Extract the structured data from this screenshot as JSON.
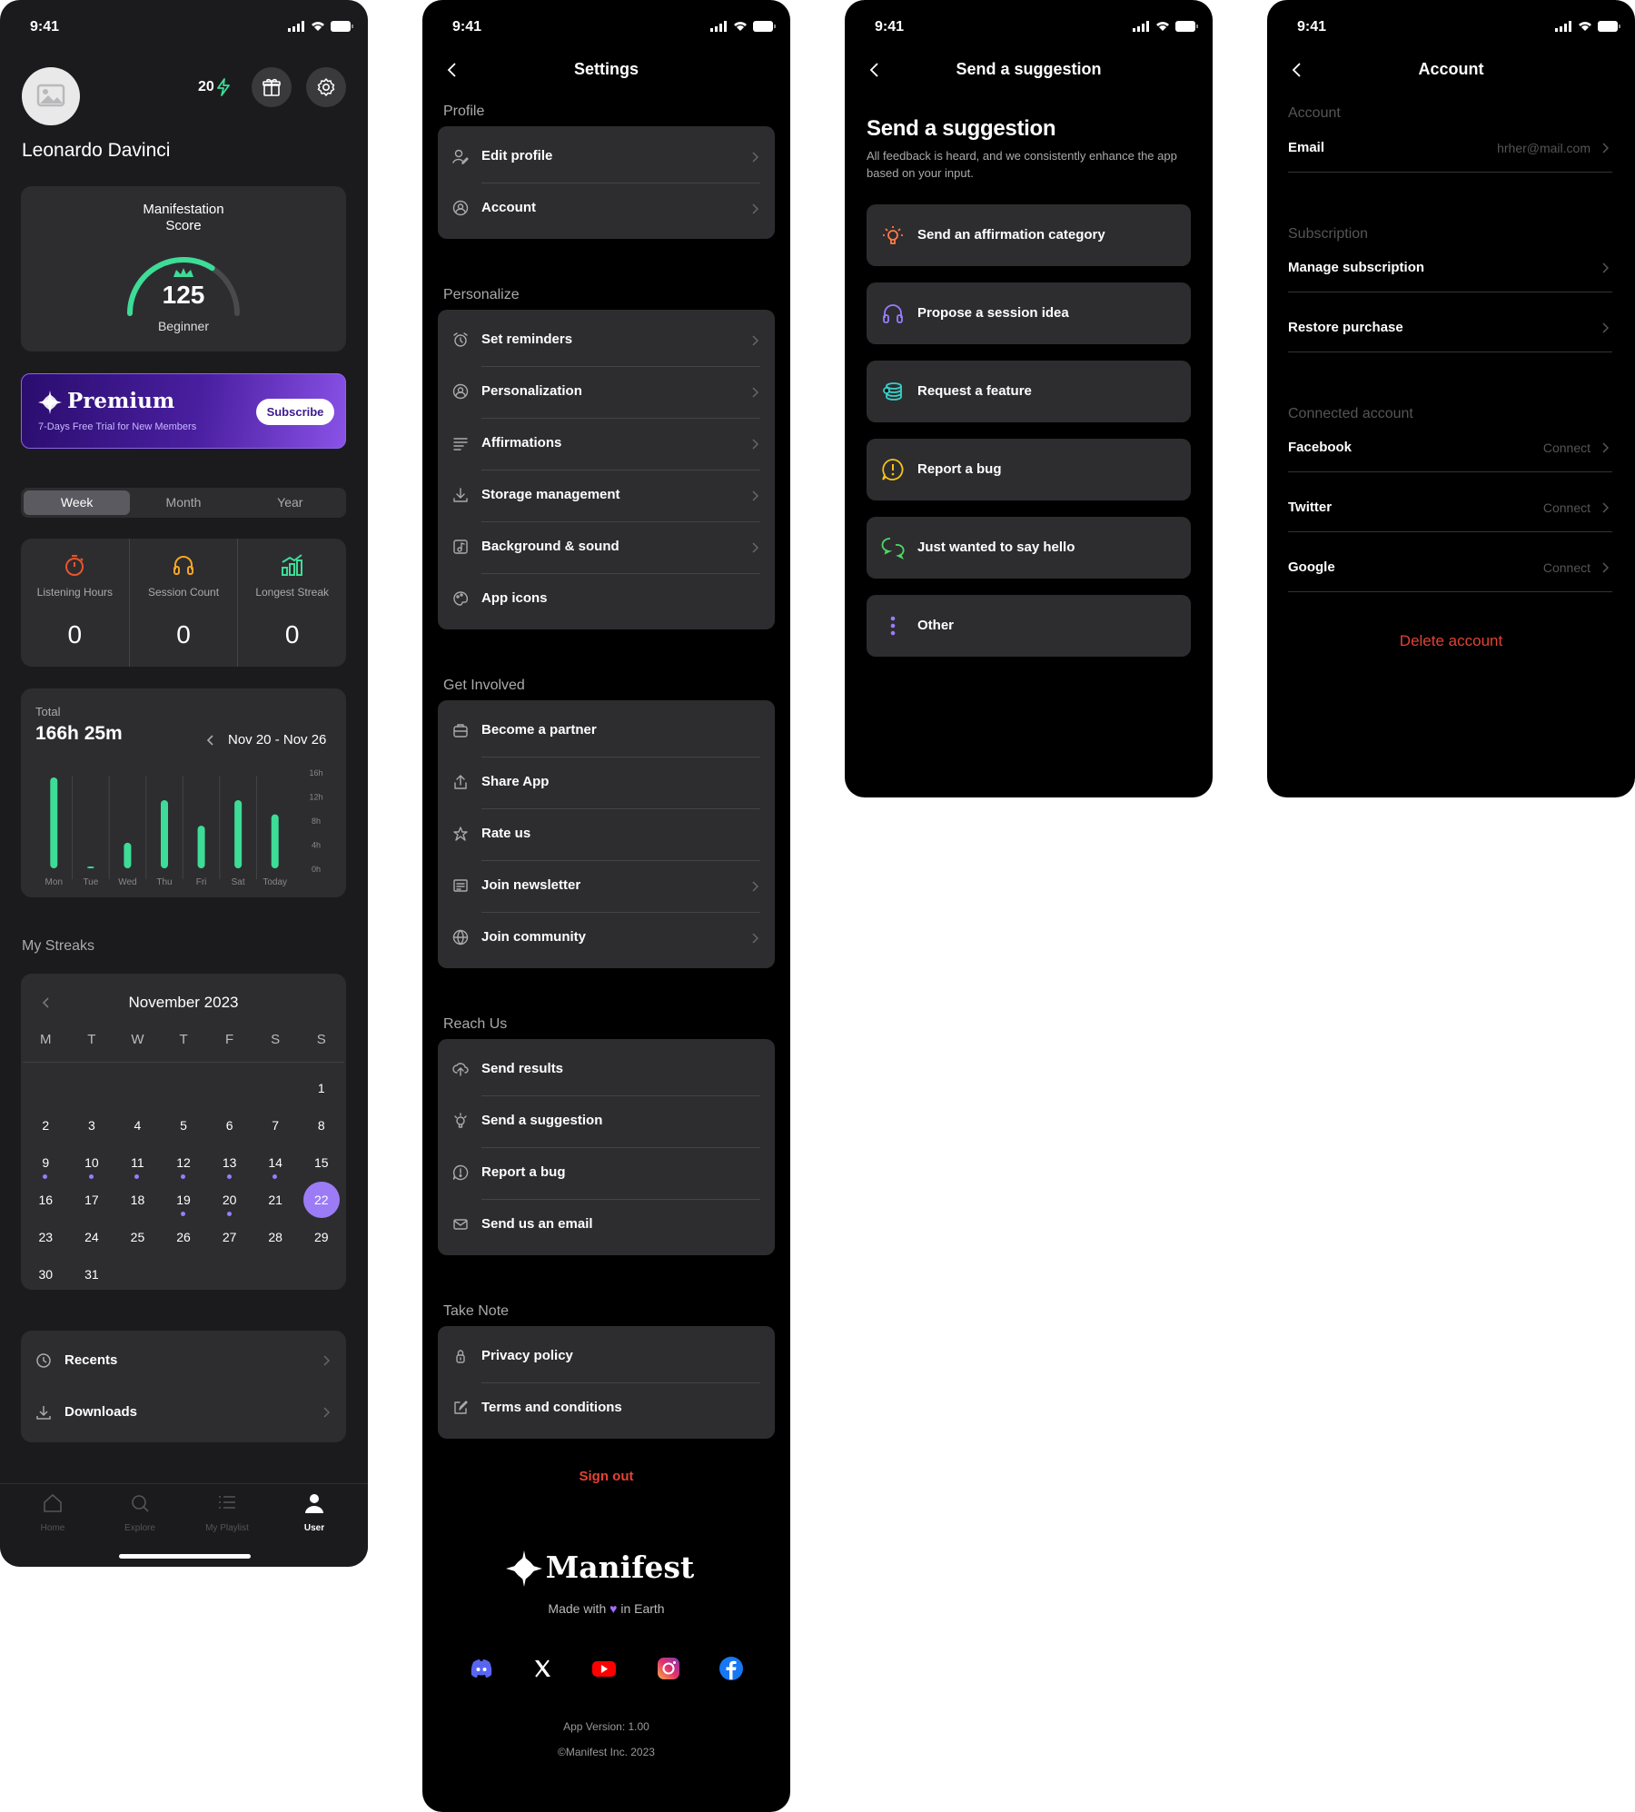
{
  "status_time": "9:41",
  "home": {
    "user_name": "Leonardo Davinci",
    "energy": "20",
    "score": {
      "title": "Manifestation Score",
      "value": "125",
      "level": "Beginner",
      "progress": 0.68
    },
    "premium": {
      "title": "Premium",
      "subtitle": "7-Days Free Trial for New Members",
      "button": "Subscribe"
    },
    "periods": [
      "Week",
      "Month",
      "Year"
    ],
    "stats": [
      {
        "label": "Listening Hours",
        "value": "0",
        "icon": "stopwatch-icon",
        "color": "#e8552c"
      },
      {
        "label": "Session Count",
        "value": "0",
        "icon": "headphones-icon",
        "color": "#f5a623"
      },
      {
        "label": "Longest Streak",
        "value": "0",
        "icon": "bar-chart-icon",
        "color": "#3ddc97"
      }
    ],
    "total": {
      "label": "Total",
      "value": "166h 25m",
      "range": "Nov 20 - Nov 26"
    },
    "chart_data": {
      "type": "bar",
      "categories": [
        "Mon",
        "Tue",
        "Wed",
        "Thu",
        "Fri",
        "Sat",
        "Today"
      ],
      "values": [
        16,
        0.3,
        4.5,
        12,
        7.5,
        12,
        9.5
      ],
      "ylim": [
        0,
        16
      ],
      "yticks": [
        "16h",
        "12h",
        "8h",
        "4h",
        "0h"
      ],
      "color": "#3ddc97"
    },
    "streaks_label": "My Streaks",
    "calendar": {
      "month": "November 2023",
      "weekdays": [
        "M",
        "T",
        "W",
        "T",
        "F",
        "S",
        "S"
      ],
      "weeks": [
        [
          "",
          "",
          "",
          "",
          "",
          "",
          "1"
        ],
        [
          "2",
          "3",
          "4",
          "5",
          "6",
          "7",
          "8"
        ],
        [
          "9",
          "10",
          "11",
          "12",
          "13",
          "14",
          "15"
        ],
        [
          "16",
          "17",
          "18",
          "19",
          "20",
          "21",
          "22"
        ],
        [
          "23",
          "24",
          "25",
          "26",
          "27",
          "28",
          "29"
        ],
        [
          "30",
          "31",
          "",
          "",
          "",
          "",
          ""
        ]
      ],
      "dotted": [
        "9",
        "10",
        "11",
        "12",
        "13",
        "14",
        "19",
        "20"
      ],
      "today": "22"
    },
    "links": [
      {
        "label": "Recents",
        "icon": "history-icon"
      },
      {
        "label": "Downloads",
        "icon": "download-icon"
      }
    ],
    "tabs": [
      {
        "label": "Home",
        "icon": "home-icon"
      },
      {
        "label": "Explore",
        "icon": "search-icon"
      },
      {
        "label": "My Playlist",
        "icon": "playlist-icon"
      },
      {
        "label": "User",
        "icon": "user-icon"
      }
    ]
  },
  "settings": {
    "title": "Settings",
    "sections": [
      {
        "title": "Profile",
        "items": [
          {
            "label": "Edit profile",
            "icon": "user-edit-icon",
            "chevron": true
          },
          {
            "label": "Account",
            "icon": "user-circle-icon",
            "chevron": true
          }
        ]
      },
      {
        "title": "Personalize",
        "items": [
          {
            "label": "Set reminders",
            "icon": "alarm-icon",
            "chevron": true
          },
          {
            "label": "Personalization",
            "icon": "user-circle-icon",
            "chevron": true
          },
          {
            "label": "Affirmations",
            "icon": "list-icon",
            "chevron": true
          },
          {
            "label": "Storage management",
            "icon": "download-icon",
            "chevron": true
          },
          {
            "label": "Background & sound",
            "icon": "music-icon",
            "chevron": true
          },
          {
            "label": "App icons",
            "icon": "palette-icon",
            "chevron": false
          }
        ]
      },
      {
        "title": "Get Involved",
        "items": [
          {
            "label": "Become a partner",
            "icon": "briefcase-icon",
            "chevron": false
          },
          {
            "label": "Share App",
            "icon": "share-icon",
            "chevron": false
          },
          {
            "label": "Rate us",
            "icon": "star-icon",
            "chevron": false
          },
          {
            "label": "Join newsletter",
            "icon": "newsletter-icon",
            "chevron": true
          },
          {
            "label": "Join community",
            "icon": "globe-icon",
            "chevron": true
          }
        ]
      },
      {
        "title": "Reach Us",
        "items": [
          {
            "label": "Send results",
            "icon": "cloud-upload-icon",
            "chevron": false
          },
          {
            "label": "Send a suggestion",
            "icon": "lightbulb-icon",
            "chevron": false
          },
          {
            "label": "Report a bug",
            "icon": "alert-icon",
            "chevron": false
          },
          {
            "label": "Send us an email",
            "icon": "mail-icon",
            "chevron": false
          }
        ]
      },
      {
        "title": "Take Note",
        "items": [
          {
            "label": "Privacy policy",
            "icon": "lock-icon",
            "chevron": false
          },
          {
            "label": "Terms and conditions",
            "icon": "edit-icon",
            "chevron": false
          }
        ]
      }
    ],
    "sign_out": "Sign out",
    "brand": "Manifest",
    "tagline_before": "Made with",
    "tagline_after": "in Earth",
    "socials": [
      "discord-icon",
      "x-icon",
      "youtube-icon",
      "instagram-icon",
      "facebook-icon"
    ],
    "version": "App Version: 1.00",
    "copyright": "©Manifest Inc. 2023"
  },
  "suggestion": {
    "nav_title": "Send a suggestion",
    "heading": "Send a suggestion",
    "description": "All feedback is heard, and we consistently enhance the app based on your input.",
    "options": [
      {
        "label": "Send an affirmation category",
        "icon": "lightbulb-icon",
        "color": "#ff7a45"
      },
      {
        "label": "Propose a session idea",
        "icon": "headphones-icon",
        "color": "#9b7cff"
      },
      {
        "label": "Request a feature",
        "icon": "stack-icon",
        "color": "#38d0c8"
      },
      {
        "label": "Report a bug",
        "icon": "alert-icon",
        "color": "#f5c518"
      },
      {
        "label": "Just wanted to say hello",
        "icon": "chat-icon",
        "color": "#4cd964"
      },
      {
        "label": "Other",
        "icon": "more-vertical-icon",
        "color": "#9b7cff"
      }
    ]
  },
  "account": {
    "title": "Account",
    "account_label": "Account",
    "email_label": "Email",
    "email_value": "hrher@mail.com",
    "subscription_label": "Subscription",
    "manage_subscription": "Manage subscription",
    "restore_purchase": "Restore purchase",
    "connected_label": "Connected account",
    "connections": [
      {
        "label": "Facebook",
        "action": "Connect"
      },
      {
        "label": "Twitter",
        "action": "Connect"
      },
      {
        "label": "Google",
        "action": "Connect"
      }
    ],
    "delete": "Delete account"
  }
}
